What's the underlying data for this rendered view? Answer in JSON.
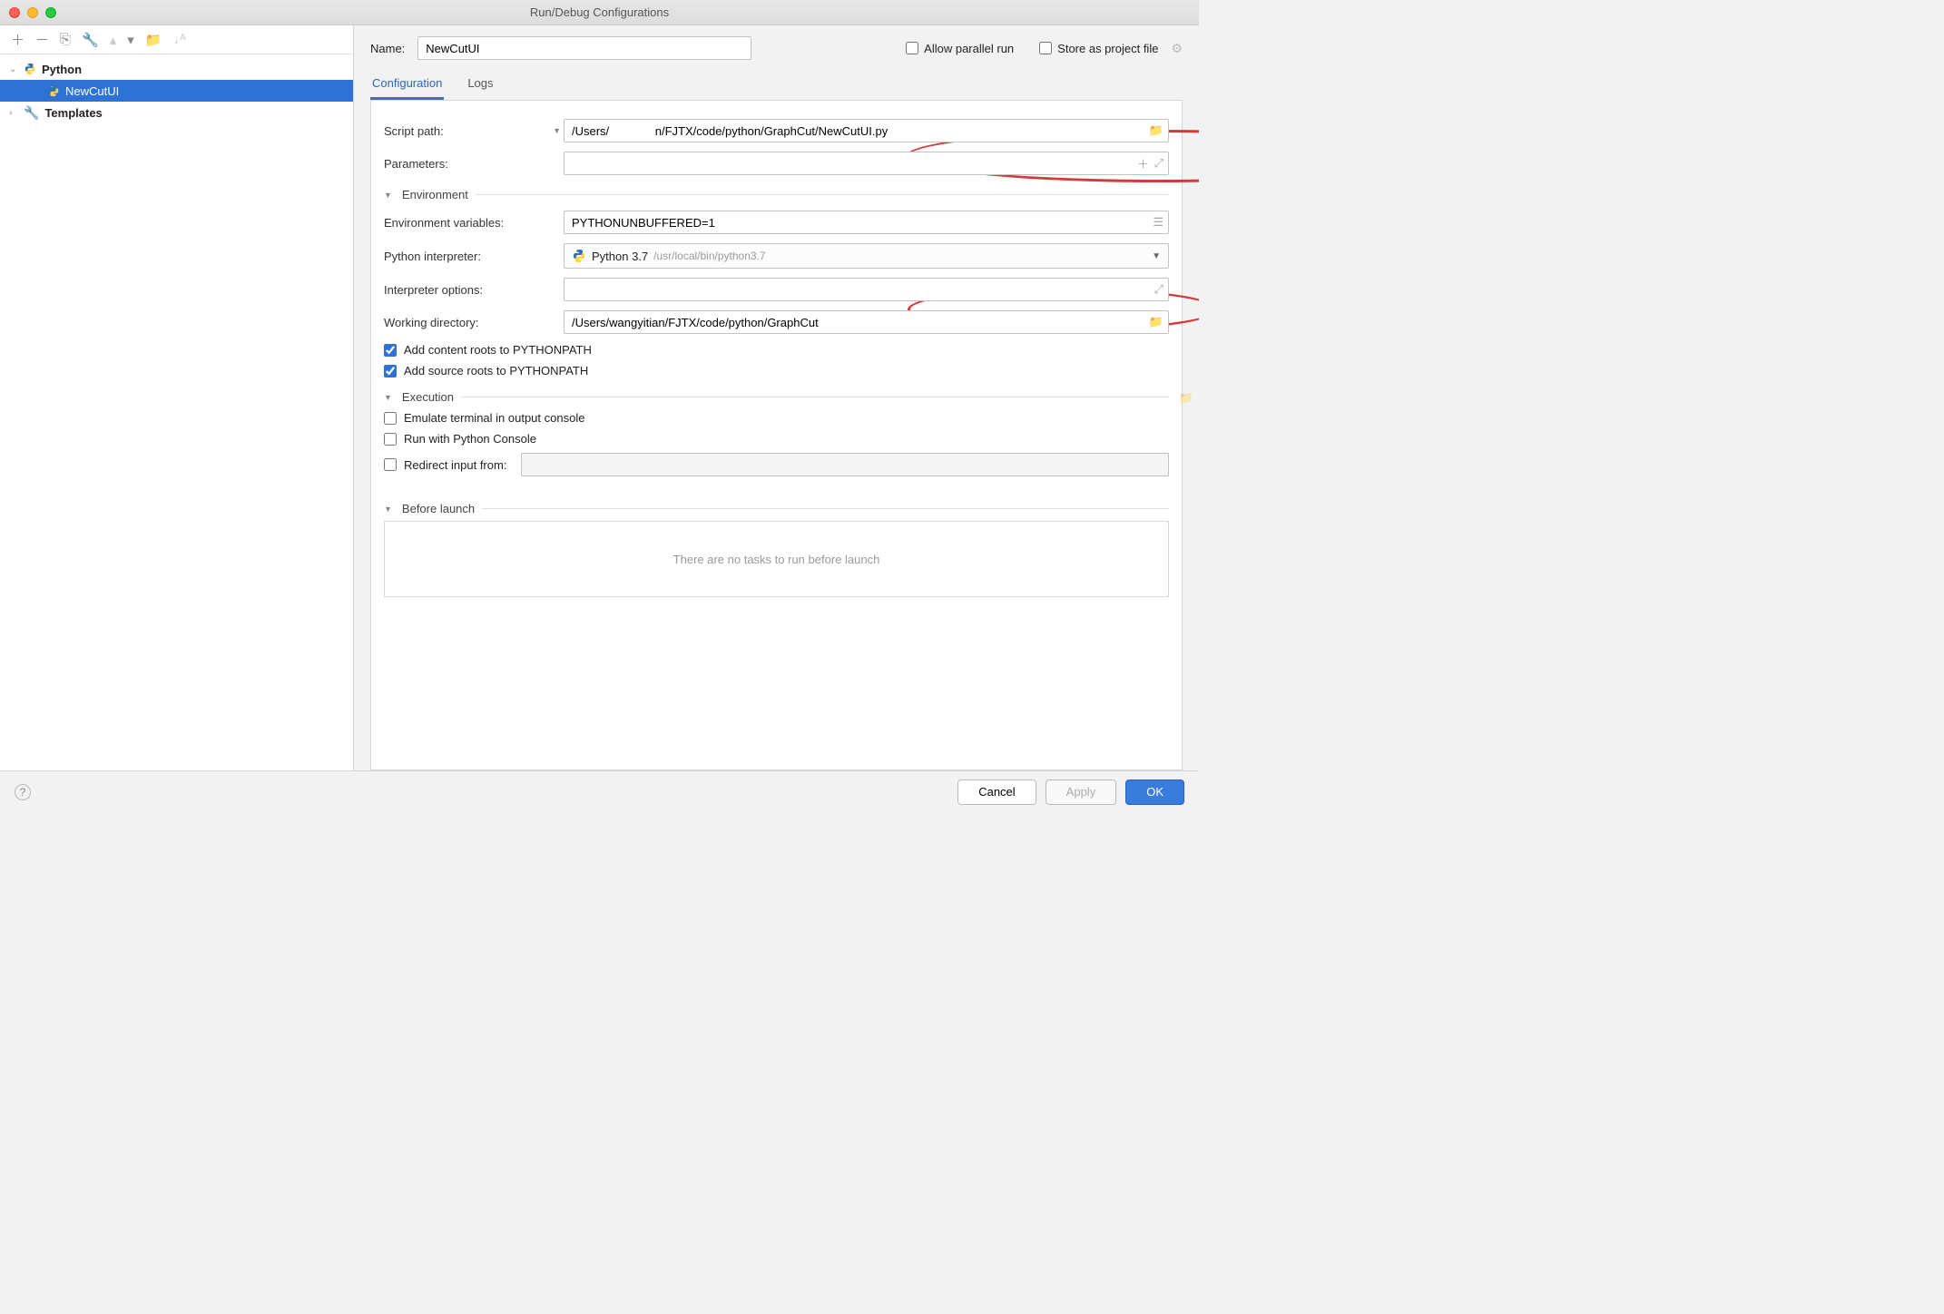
{
  "window": {
    "title": "Run/Debug Configurations"
  },
  "sidebar": {
    "items": [
      {
        "label": "Python",
        "expanded": true
      },
      {
        "label": "NewCutUI",
        "selected": true
      },
      {
        "label": "Templates"
      }
    ]
  },
  "header": {
    "name_label": "Name:",
    "name_value": "NewCutUI",
    "allow_parallel": "Allow parallel run",
    "store_project": "Store as project file"
  },
  "tabs": {
    "configuration": "Configuration",
    "logs": "Logs"
  },
  "form": {
    "script_path_label": "Script path:",
    "script_path_value": "/Users/              n/FJTX/code/python/GraphCut/NewCutUI.py",
    "parameters_label": "Parameters:",
    "env_section": "Environment",
    "env_vars_label": "Environment variables:",
    "env_vars_value": "PYTHONUNBUFFERED=1",
    "interpreter_label": "Python interpreter:",
    "interpreter_name": "Python 3.7",
    "interpreter_path": "/usr/local/bin/python3.7",
    "interpreter_opts_label": "Interpreter options:",
    "workdir_label": "Working directory:",
    "workdir_value": "/Users/wangyitian/FJTX/code/python/GraphCut",
    "add_content_roots": "Add content roots to PYTHONPATH",
    "add_source_roots": "Add source roots to PYTHONPATH",
    "execution_section": "Execution",
    "emulate_terminal": "Emulate terminal in output console",
    "run_python_console": "Run with Python Console",
    "redirect_input": "Redirect input from:",
    "before_launch_section": "Before launch",
    "before_launch_empty": "There are no tasks to run before launch"
  },
  "footer": {
    "cancel": "Cancel",
    "apply": "Apply",
    "ok": "OK"
  }
}
